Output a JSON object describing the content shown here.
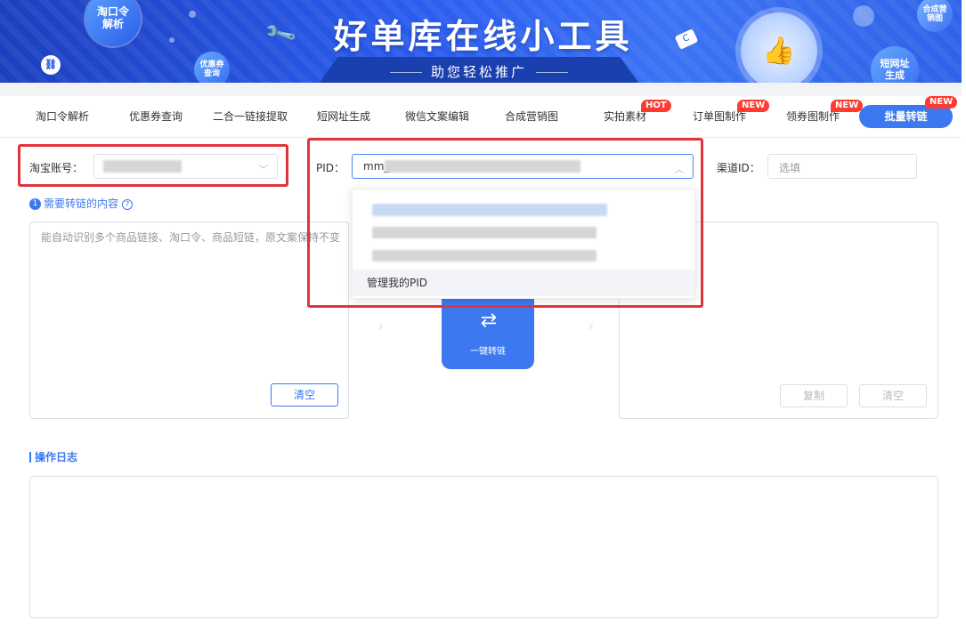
{
  "banner": {
    "title": "好单库在线小工具",
    "subtitle": "助您轻松推广",
    "bubble_taokouling": "淘口令解析",
    "bubble_coupon": "优惠券查询",
    "bubble_shorturl": "短网址生成",
    "bubble_marketing": "合成营销图"
  },
  "nav": {
    "tabs": [
      {
        "label": "淘口令解析"
      },
      {
        "label": "优惠券查询"
      },
      {
        "label": "二合一链接提取"
      },
      {
        "label": "短网址生成"
      },
      {
        "label": "微信文案编辑"
      },
      {
        "label": "合成营销图"
      },
      {
        "label": "实拍素材",
        "badge": "HOT"
      },
      {
        "label": "订单图制作",
        "badge": "NEW"
      },
      {
        "label": "领券图制作",
        "badge": "NEW"
      },
      {
        "label": "批量转链",
        "badge": "NEW",
        "active": true
      }
    ]
  },
  "form": {
    "taobao_account_label": "淘宝账号：",
    "pid_label": "PID：",
    "pid_value_prefix": "mm_",
    "channel_label": "渠道ID：",
    "channel_placeholder": "选填"
  },
  "dropdown": {
    "manage_label": "管理我的PID"
  },
  "content": {
    "step_number": "1",
    "step_label": "需要转链的内容",
    "input_placeholder": "能自动识别多个商品链接、淘口令、商品短链，原文案保持不变",
    "clear_label": "清空",
    "convert_label": "一键转链",
    "copy_label": "复制",
    "output_clear_label": "清空"
  },
  "log": {
    "title": "操作日志"
  },
  "colors": {
    "accent": "#3c78f0",
    "hot_badge": "#ff3b30",
    "highlight_box": "#e0343c"
  }
}
